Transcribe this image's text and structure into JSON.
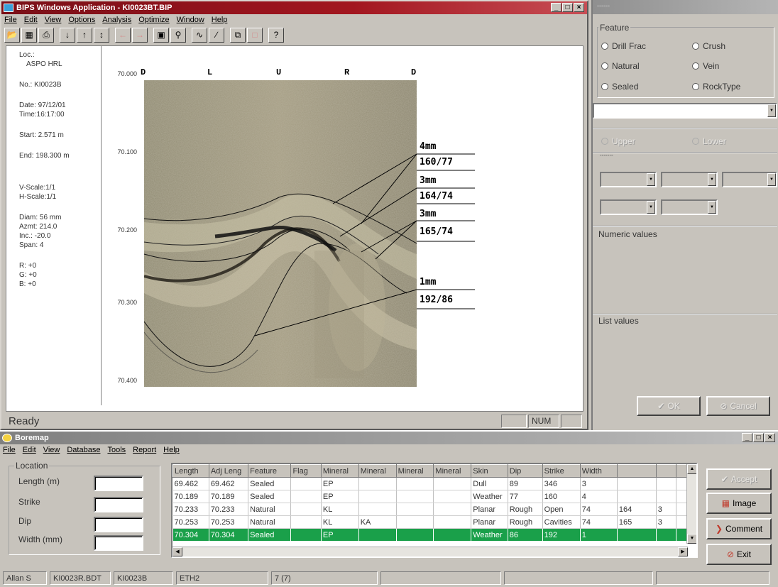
{
  "bips": {
    "title": "BIPS Windows Application - KI0023BT.BIP",
    "menu": [
      "File",
      "Edit",
      "View",
      "Options",
      "Analysis",
      "Optimize",
      "Window",
      "Help"
    ],
    "info": {
      "loc_label": "Loc.:",
      "loc_value": "ASPO HRL",
      "no": "No.: KI0023B",
      "date": "Date: 97/12/01",
      "time": "Time:16:17:00",
      "start": "Start: 2.571   m",
      "end": "End: 198.300 m",
      "vscale": "V-Scale:1/1",
      "hscale": "H-Scale:1/1",
      "diam": "Diam:  56  mm",
      "azmt": "Azmt: 214.0",
      "inc": "Inc.:   -20.0",
      "span": "Span: 4",
      "r": "R:    +0",
      "g": "G:    +0",
      "b": "B:    +0"
    },
    "depths": [
      "70.000",
      "70.100",
      "70.200",
      "70.300",
      "70.400"
    ],
    "orient_ticks": [
      "D",
      "L",
      "U",
      "R",
      "D"
    ],
    "annotations": [
      {
        "aperture": "4mm",
        "orientation": "160/77"
      },
      {
        "aperture": "3mm",
        "orientation": "164/74"
      },
      {
        "aperture": "3mm",
        "orientation": "165/74"
      },
      {
        "aperture": "1mm",
        "orientation": "192/86"
      }
    ],
    "status": {
      "text": "Ready",
      "num": "NUM"
    }
  },
  "feature_panel": {
    "title": "------",
    "feature_label": "Feature",
    "features": [
      "Drill Frac",
      "Crush",
      "Natural",
      "Vein",
      "Sealed",
      "RockType"
    ],
    "upper": "Upper",
    "lower": "Lower",
    "dashes": "-------",
    "numeric_label": "Numeric values",
    "list_label": "List values",
    "ok": "OK",
    "cancel": "Cancel"
  },
  "boremap": {
    "title": "Boremap",
    "menu": [
      "File",
      "Edit",
      "View",
      "Database",
      "Tools",
      "Report",
      "Help"
    ],
    "location": {
      "group_label": "Location",
      "fields": [
        "Length (m)",
        "Strike",
        "Dip",
        "Width (mm)"
      ]
    },
    "columns": [
      "Length",
      "Adj Leng",
      "Feature",
      "Flag",
      "Mineral",
      "Mineral",
      "Mineral",
      "Mineral",
      "Skin",
      "Dip",
      "Strike",
      "Width",
      "",
      "",
      ""
    ],
    "rows": [
      [
        "69.462",
        "69.462",
        "Sealed",
        "",
        "EP",
        "",
        "",
        "",
        "Dull",
        "89",
        "346",
        "3",
        "",
        "",
        ""
      ],
      [
        "70.189",
        "70.189",
        "Sealed",
        "",
        "EP",
        "",
        "",
        "",
        "Weather",
        "77",
        "160",
        "4",
        "",
        "",
        ""
      ],
      [
        "70.233",
        "70.233",
        "Natural",
        "",
        "KL",
        "",
        "",
        "",
        "Planar",
        "Rough",
        "Open",
        "74",
        "164",
        "3",
        ""
      ],
      [
        "70.253",
        "70.253",
        "Natural",
        "",
        "KL",
        "KA",
        "",
        "",
        "Planar",
        "Rough",
        "Cavities",
        "74",
        "165",
        "3",
        ""
      ],
      [
        "70.304",
        "70.304",
        "Sealed",
        "",
        "EP",
        "",
        "",
        "",
        "Weather",
        "86",
        "192",
        "1",
        "",
        "",
        ""
      ]
    ],
    "buttons": {
      "accept": "Accept",
      "image": "Image",
      "comment": "Comment",
      "exit": "Exit"
    },
    "status": [
      "Allan S",
      "KI0023R.BDT",
      "KI0023B",
      "ETH2",
      "7 (7)"
    ]
  }
}
